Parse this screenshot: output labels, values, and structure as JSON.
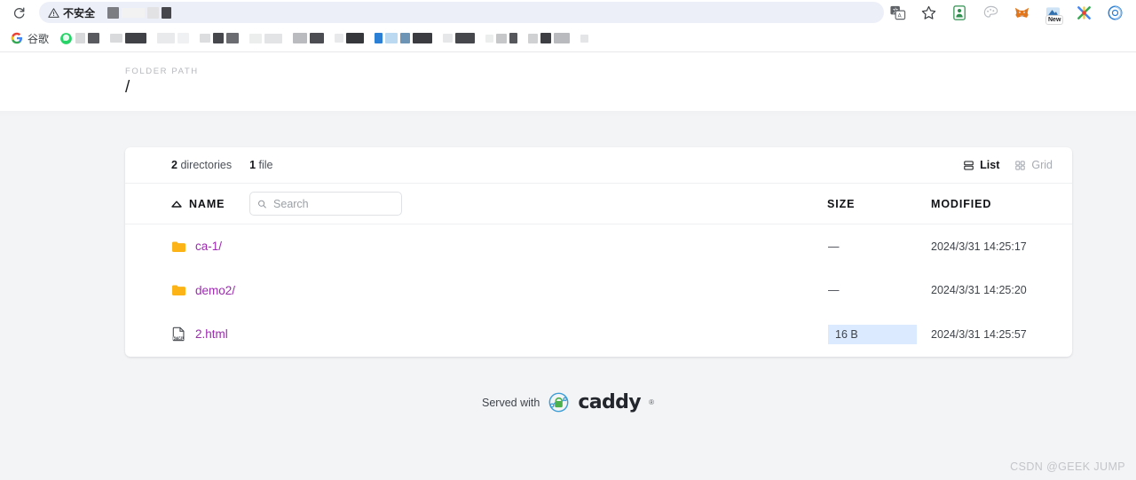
{
  "browser": {
    "reload_icon": "reload-icon",
    "security_chip": {
      "icon": "warning-triangle-icon",
      "label": "不安全"
    },
    "url_redacted": true,
    "right_icons": [
      {
        "name": "translate-icon"
      },
      {
        "name": "bookmark-star-icon"
      },
      {
        "name": "extension-green-person-icon"
      },
      {
        "name": "extension-palette-icon"
      },
      {
        "name": "metamask-fox-icon"
      },
      {
        "name": "extension-new-icon",
        "badge": "New"
      },
      {
        "name": "extension-x-icon"
      },
      {
        "name": "extension-blue-circle-icon"
      }
    ],
    "bookmarks": {
      "first": {
        "icon": "google-g-icon",
        "label": "谷歌"
      },
      "redacted_count": 11
    }
  },
  "page": {
    "folder_path_label": "FOLDER PATH",
    "folder_path_value": "/",
    "summary": {
      "dir_count": "2",
      "dir_word": "directories",
      "file_count": "1",
      "file_word": "file"
    },
    "view": {
      "list_label": "List",
      "list_icon": "list-view-icon",
      "grid_label": "Grid",
      "grid_icon": "grid-view-icon",
      "active": "List"
    },
    "columns": {
      "name": "NAME",
      "size": "SIZE",
      "modified": "MODIFIED",
      "sort_icon": "sort-ascending-triangle-icon"
    },
    "search": {
      "placeholder": "Search",
      "value": "",
      "icon": "search-icon"
    },
    "rows": [
      {
        "icon": "folder-icon",
        "name": "ca-1/",
        "size": "—",
        "size_highlight": false,
        "modified": "2024/3/31 14:25:17"
      },
      {
        "icon": "folder-icon",
        "name": "demo2/",
        "size": "—",
        "size_highlight": false,
        "modified": "2024/3/31 14:25:20"
      },
      {
        "icon": "html-file-icon",
        "name": "2.html",
        "size": "16 B",
        "size_highlight": true,
        "modified": "2024/3/31 14:25:57"
      }
    ],
    "footer": {
      "served_with": "Served with",
      "brand": "caddy",
      "trademark": "®",
      "logo_icon": "caddy-logo-icon"
    },
    "watermark": "CSDN @GEEK JUMP"
  },
  "colors": {
    "folder": "#fbb316",
    "link": "#9c2bb0",
    "size_highlight": "#dbeafe",
    "page_bg": "#f3f4f6",
    "card_bg": "#ffffff"
  }
}
